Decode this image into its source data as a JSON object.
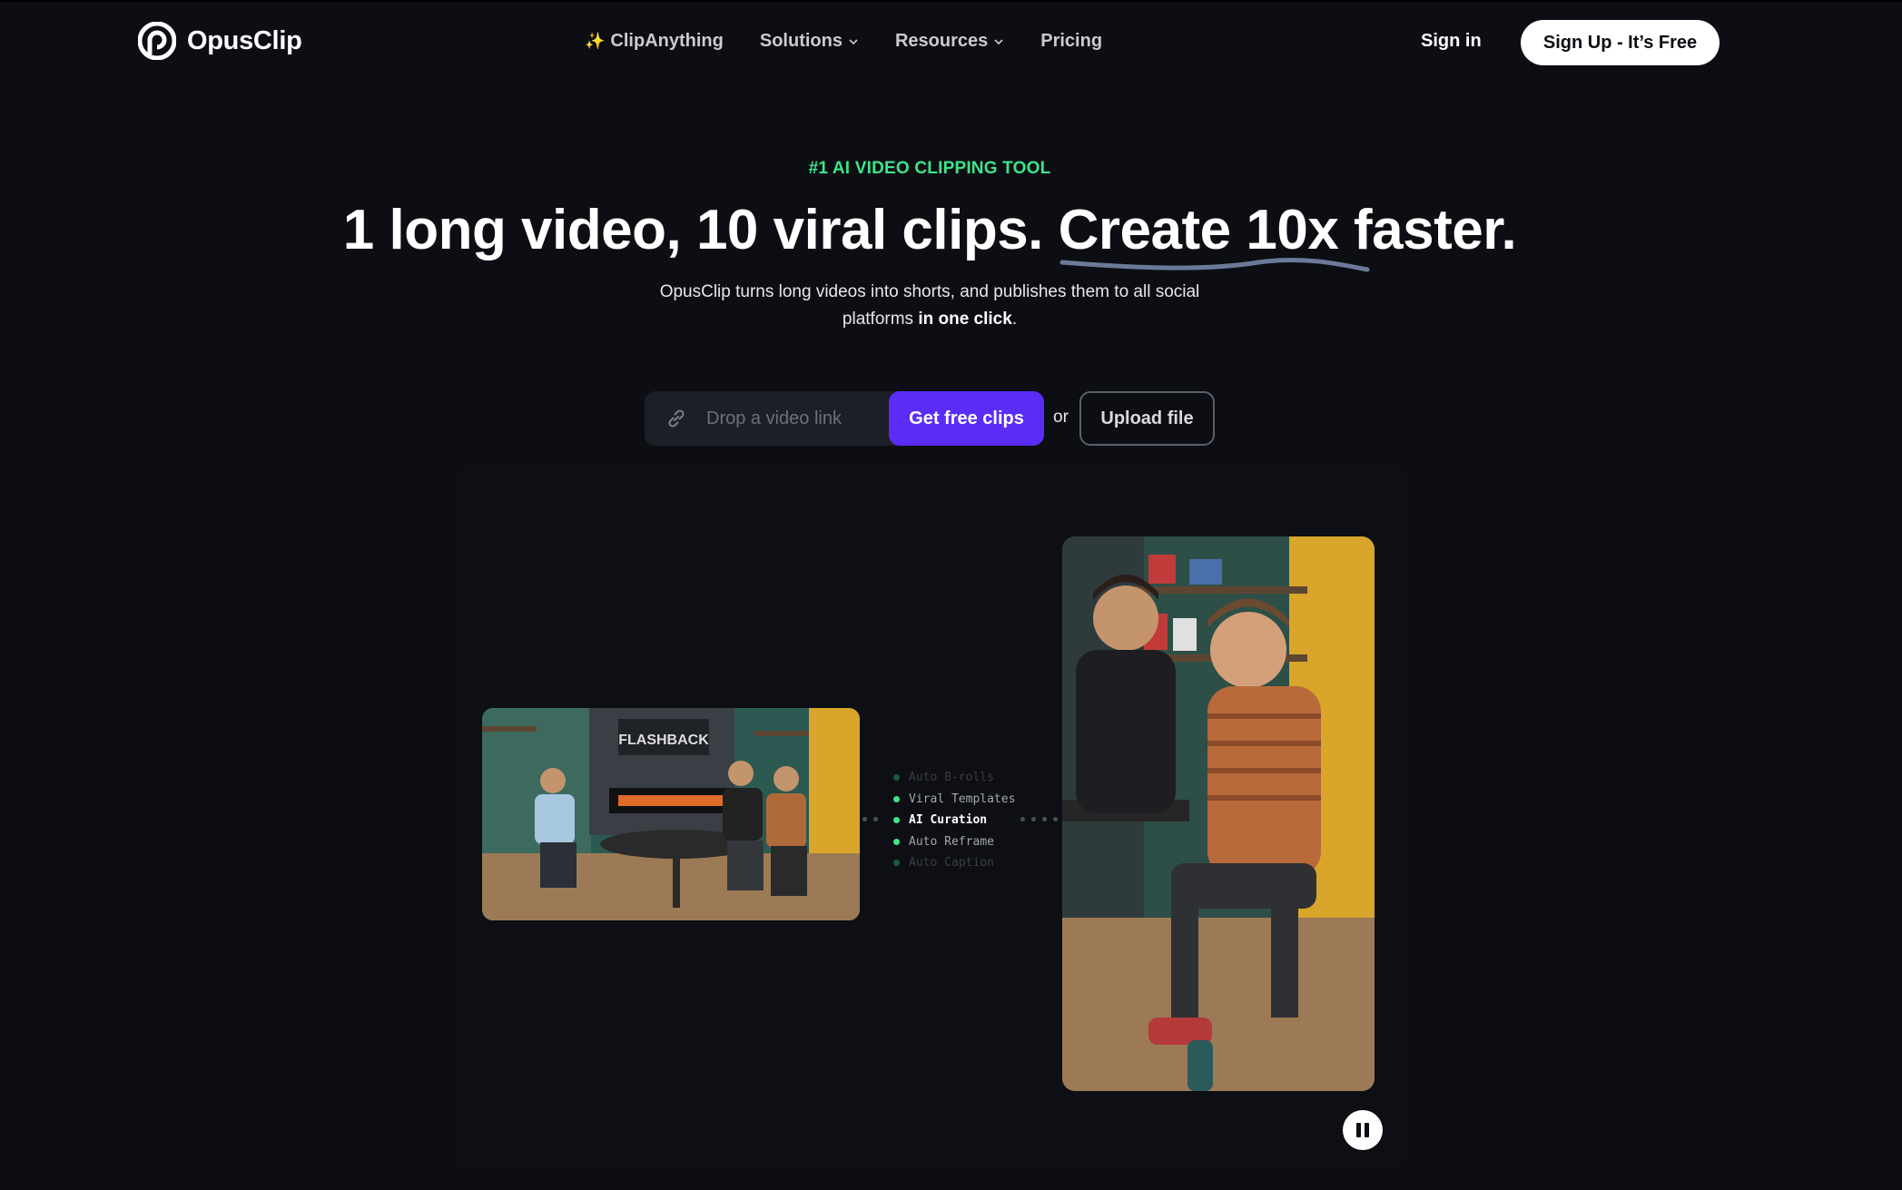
{
  "brand": {
    "name": "OpusClip"
  },
  "nav": {
    "items": [
      {
        "label": "ClipAnything",
        "icon": "sparkle-icon"
      },
      {
        "label": "Solutions",
        "icon": "chevron-down-icon"
      },
      {
        "label": "Resources",
        "icon": "chevron-down-icon"
      },
      {
        "label": "Pricing"
      }
    ],
    "sign_in": "Sign in",
    "sign_up": "Sign Up - It’s Free"
  },
  "hero": {
    "eyebrow": "#1 AI VIDEO CLIPPING TOOL",
    "headline_part1": "1 long video, 10 viral clips. ",
    "headline_highlight": "Create 10x",
    "headline_part2": " faster.",
    "subtext_line1": "OpusClip turns long videos into shorts, and publishes them to all social",
    "subtext_line2_plain": "platforms ",
    "subtext_line2_bold": "in one click",
    "subtext_line2_end": "."
  },
  "input_row": {
    "placeholder": "Drop a video link",
    "cta": "Get free clips",
    "or": "or",
    "upload": "Upload file"
  },
  "features": [
    "Auto B-rolls",
    "Viral Templates",
    "AI Curation",
    "Auto Reframe",
    "Auto Caption"
  ],
  "colors": {
    "accent": "#5b2cf6",
    "eyebrow": "#3ee48a",
    "background": "#0c0e13"
  }
}
